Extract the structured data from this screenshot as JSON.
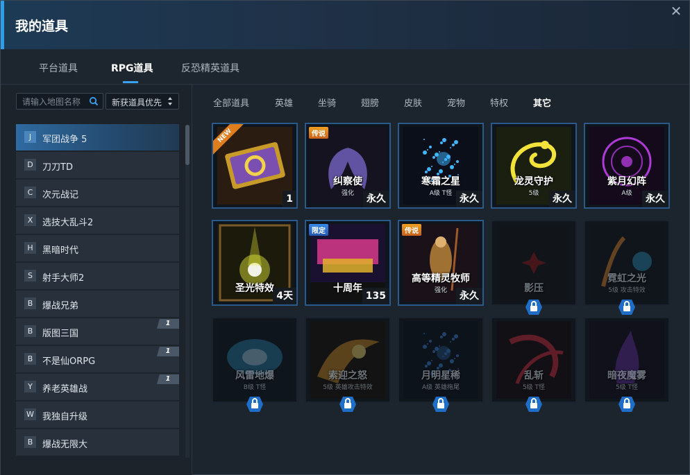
{
  "window": {
    "title": "我的道具",
    "close_glyph": "✕"
  },
  "tabs": [
    {
      "label": "平台道具"
    },
    {
      "label": "RPG道具"
    },
    {
      "label": "反恐精英道具"
    }
  ],
  "search": {
    "placeholder": "请输入地图名称"
  },
  "sort": {
    "label": "新获道具优先"
  },
  "maps": [
    {
      "letter": "J",
      "name": "军团战争 5",
      "badge": ""
    },
    {
      "letter": "D",
      "name": "刀刀TD",
      "badge": ""
    },
    {
      "letter": "C",
      "name": "次元战记",
      "badge": ""
    },
    {
      "letter": "X",
      "name": "选技大乱斗2",
      "badge": ""
    },
    {
      "letter": "H",
      "name": "黑暗时代",
      "badge": ""
    },
    {
      "letter": "S",
      "name": "射手大师2",
      "badge": ""
    },
    {
      "letter": "B",
      "name": "爆战兄弟",
      "badge": ""
    },
    {
      "letter": "B",
      "name": "版图三国",
      "badge": "1"
    },
    {
      "letter": "B",
      "name": "不是仙ORPG",
      "badge": "1"
    },
    {
      "letter": "Y",
      "name": "养老英雄战",
      "badge": "1"
    },
    {
      "letter": "W",
      "name": "我独自升级",
      "badge": ""
    },
    {
      "letter": "B",
      "name": "爆战无限大",
      "badge": ""
    }
  ],
  "categories": [
    {
      "label": "全部道具"
    },
    {
      "label": "英雄"
    },
    {
      "label": "坐骑"
    },
    {
      "label": "翅膀"
    },
    {
      "label": "皮肤"
    },
    {
      "label": "宠物"
    },
    {
      "label": "特权"
    },
    {
      "label": "其它"
    }
  ],
  "items": [
    {
      "name": "",
      "sub": "",
      "tag": "",
      "ribbon": "NEW",
      "qty": "1",
      "locked": false,
      "art": "ticket",
      "color": "#c79a2a"
    },
    {
      "name": "纠察使",
      "sub": "强化",
      "tag": "传说",
      "ribbon": "",
      "qty": "永久",
      "locked": false,
      "art": "wing",
      "color": "#6f5fb8"
    },
    {
      "name": "寒霜之星",
      "sub": "A级 T怪",
      "tag": "",
      "ribbon": "",
      "qty": "永久",
      "locked": false,
      "art": "sparkle",
      "color": "#3fb6ff"
    },
    {
      "name": "龙灵守护",
      "sub": "5级",
      "tag": "",
      "ribbon": "",
      "qty": "永久",
      "locked": false,
      "art": "dragon",
      "color": "#f2e23a"
    },
    {
      "name": "紫月幻阵",
      "sub": "A级",
      "tag": "",
      "ribbon": "",
      "qty": "永久",
      "locked": false,
      "art": "ring",
      "color": "#b03ad8"
    },
    {
      "name": "圣光特效",
      "sub": "",
      "tag": "",
      "ribbon": "",
      "qty": "4天",
      "locked": false,
      "art": "burst",
      "color": "#e8f03a"
    },
    {
      "name": "十周年",
      "sub": "",
      "tag": "限定",
      "ribbon": "",
      "qty": "135",
      "locked": false,
      "art": "anniv",
      "color": "#d83a8a"
    },
    {
      "name": "高等精灵牧师",
      "sub": "强化",
      "tag": "传说",
      "ribbon": "",
      "qty": "永久",
      "locked": false,
      "art": "hero",
      "color": "#c08a3a"
    },
    {
      "name": "影压",
      "sub": "",
      "tag": "",
      "ribbon": "",
      "qty": "",
      "locked": true,
      "art": "shadow",
      "color": "#a01818"
    },
    {
      "name": "霓虹之光",
      "sub": "5级 攻击特效",
      "tag": "",
      "ribbon": "",
      "qty": "",
      "locked": true,
      "art": "neon",
      "color": "#e88a2a"
    },
    {
      "name": "风雷地爆",
      "sub": "B级 T怪",
      "tag": "",
      "ribbon": "",
      "qty": "",
      "locked": true,
      "art": "storm",
      "color": "#3ac0ff"
    },
    {
      "name": "索迎之怒",
      "sub": "5级 英雄攻击特效",
      "tag": "",
      "ribbon": "",
      "qty": "",
      "locked": true,
      "art": "fire",
      "color": "#f0a020"
    },
    {
      "name": "月明星稀",
      "sub": "A级 英雄拖尾",
      "tag": "",
      "ribbon": "",
      "qty": "",
      "locked": true,
      "art": "sparkle",
      "color": "#3a8ae8"
    },
    {
      "name": "乱斩",
      "sub": "5级 T怪",
      "tag": "",
      "ribbon": "",
      "qty": "",
      "locked": true,
      "art": "slash",
      "color": "#e02a3a"
    },
    {
      "name": "暗夜魔雾",
      "sub": "5级 T怪",
      "tag": "",
      "ribbon": "",
      "qty": "",
      "locked": true,
      "art": "mist",
      "color": "#8a3ad8"
    }
  ],
  "icons": {
    "search": "search-icon",
    "sort": "sort-arrows-icon",
    "close": "close-icon",
    "lock": "lock-icon"
  },
  "colors": {
    "accent": "#3aa0f0",
    "card_border": "#2a5a8a",
    "badge": "#4a5766"
  }
}
